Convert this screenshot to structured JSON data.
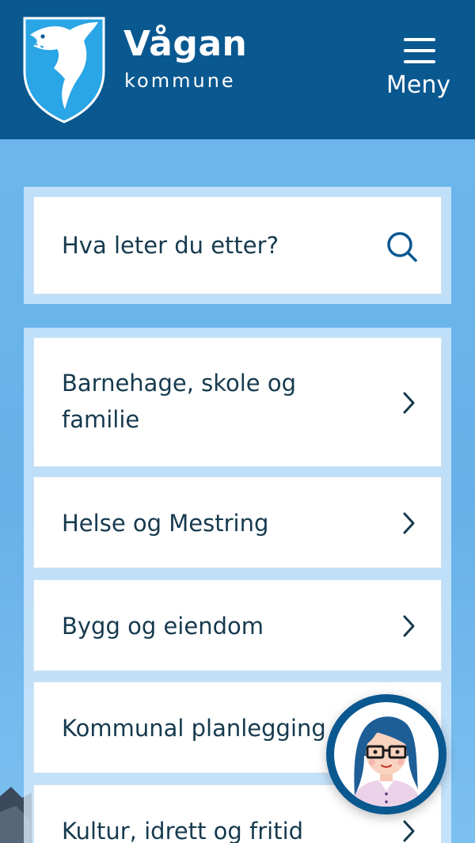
{
  "header": {
    "brand_name": "Vågan",
    "brand_sub": "kommune",
    "logo_icon": "vagan-coat-of-arms-icon",
    "menu_label": "Meny",
    "menu_icon": "hamburger-icon"
  },
  "search": {
    "placeholder": "Hva leter du etter?",
    "icon": "search-icon"
  },
  "nav": {
    "items": [
      {
        "label_line1": "Barnehage, skole og",
        "label_line2": "familie"
      },
      {
        "label": "Helse og Mestring"
      },
      {
        "label": "Bygg og eiendom"
      },
      {
        "label": "Kommunal planlegging"
      },
      {
        "label": "Kultur, idrett og fritid"
      }
    ],
    "chevron_icon": "chevron-right-icon"
  },
  "chat": {
    "icon": "chatbot-avatar-icon"
  },
  "colors": {
    "header_bg": "#0a5890",
    "page_bg": "#6fb8ee",
    "text_dark": "#163a4e",
    "accent": "#0a5890",
    "logo_blue": "#2aa5e6"
  }
}
